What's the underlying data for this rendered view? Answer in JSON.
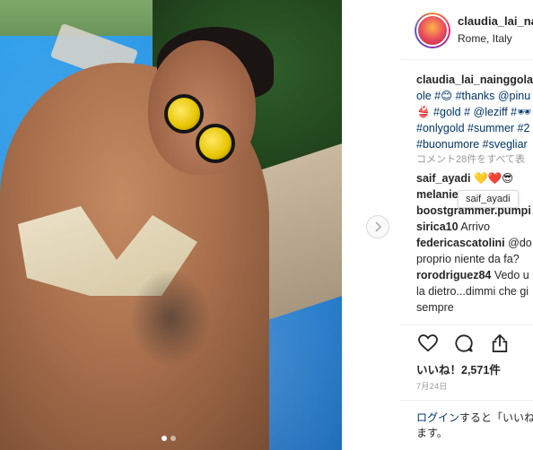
{
  "post": {
    "username": "claudia_lai_na",
    "location": "Rome, Italy"
  },
  "caption": {
    "line1_user": "claudia_lai_nainggolar",
    "line2": "ole #😊 #thanks @pinu",
    "line3": "👙 #gold # @leziff #🕶",
    "line4": "#onlygold #summer #2",
    "line5": "#buonumore #svegliar"
  },
  "view_all_comments": "コメント28件をすべて表",
  "comments": [
    {
      "user": "saif_ayadi",
      "text": " 💛❤️😎"
    },
    {
      "user": "melanie",
      "text": ""
    },
    {
      "user": "boostgrammer.pumpi",
      "text": ""
    },
    {
      "user": "sirica10",
      "text": " Arrivo"
    },
    {
      "user": "federicascatolini",
      "text": " @do"
    },
    {
      "user": "",
      "text": "proprio niente da fa?"
    },
    {
      "user": "rorodriguez84",
      "text": " Vedo u"
    },
    {
      "user": "",
      "text": "la dietro...dimmi che gi"
    },
    {
      "user": "",
      "text": "sempre"
    }
  ],
  "tooltip": "saif_ayadi",
  "likes": "いいね！2,571件",
  "date": "7月24日",
  "login": {
    "link": "ログイン",
    "text1": "すると「いいね",
    "text2": "ます。"
  },
  "icons": {
    "like": "heart-icon",
    "comment": "comment-icon",
    "share": "share-icon",
    "next": "chevron-right-icon"
  }
}
